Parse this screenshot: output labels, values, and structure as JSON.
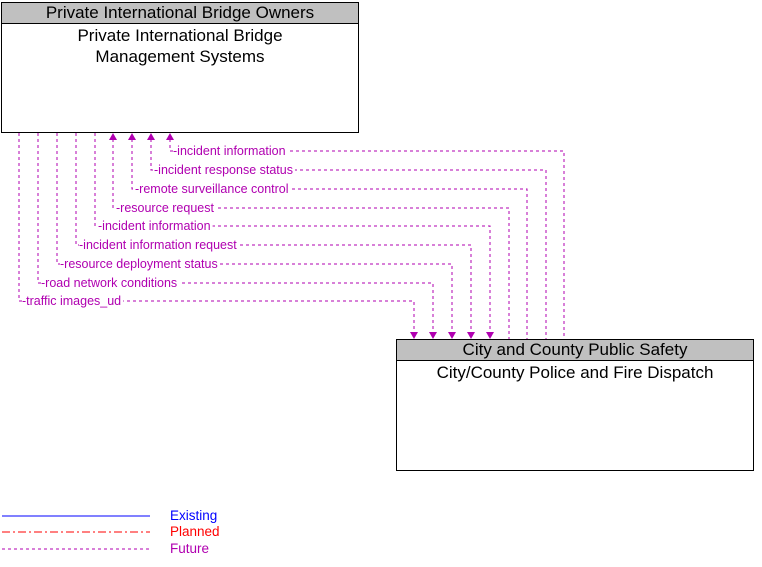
{
  "colors": {
    "existing": "#0000ff",
    "planned": "#ff0000",
    "future": "#b000b0",
    "header_bg": "#c0c0c0"
  },
  "top_box": {
    "header": "Private International Bridge Owners",
    "body_line1": "Private International Bridge",
    "body_line2": "Management Systems"
  },
  "bottom_box": {
    "header": "City and County Public Safety",
    "body": "City/County Police and Fire Dispatch"
  },
  "flows": [
    {
      "label": "incident information",
      "direction": "to-top",
      "status": "future"
    },
    {
      "label": "incident response status",
      "direction": "to-top",
      "status": "future"
    },
    {
      "label": "remote surveillance control",
      "direction": "to-top",
      "status": "future"
    },
    {
      "label": "resource request",
      "direction": "to-top",
      "status": "future"
    },
    {
      "label": "incident information",
      "direction": "to-bottom",
      "status": "future"
    },
    {
      "label": "incident information request",
      "direction": "to-bottom",
      "status": "future"
    },
    {
      "label": "resource deployment status",
      "direction": "to-bottom",
      "status": "future"
    },
    {
      "label": "road network conditions",
      "direction": "to-bottom",
      "status": "future"
    },
    {
      "label": "traffic images_ud",
      "direction": "to-bottom",
      "status": "future"
    }
  ],
  "legend": {
    "existing": "Existing",
    "planned": "Planned",
    "future": "Future"
  }
}
